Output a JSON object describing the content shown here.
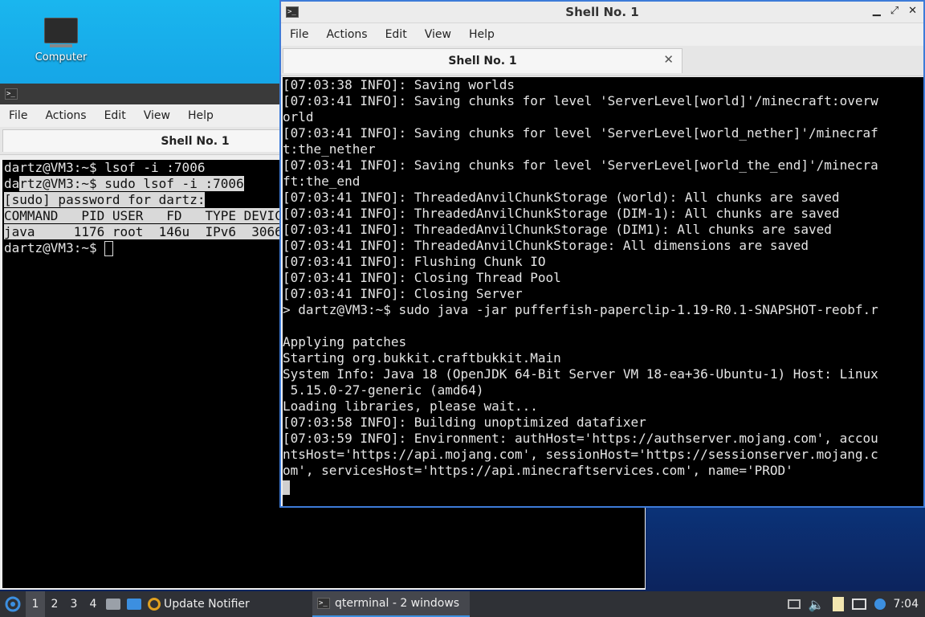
{
  "desktop": {
    "computer_label": "Computer"
  },
  "back_window": {
    "menu": [
      "File",
      "Actions",
      "Edit",
      "View",
      "Help"
    ],
    "tab_title": "Shell No. 1",
    "lines": [
      {
        "text": "dartz@VM3:~$ lsof -i :7006",
        "hl": false
      },
      {
        "text": "dartz@VM3:~$ sudo lsof -i :7006",
        "hl": true,
        "hl_from": 2
      },
      {
        "text": "[sudo] password for dartz:",
        "hl": true
      },
      {
        "text": "COMMAND   PID USER   FD   TYPE DEVIC",
        "hl": true
      },
      {
        "text": "java     1176 root  146u  IPv6  3066",
        "hl": true
      },
      {
        "text": "dartz@VM3:~$ ",
        "hl": false,
        "cursor": true
      }
    ]
  },
  "front_window": {
    "title": "Shell No. 1",
    "menu": [
      "File",
      "Actions",
      "Edit",
      "View",
      "Help"
    ],
    "tab_title": "Shell No. 1",
    "lines": [
      "[07:03:38 INFO]: Saving worlds",
      "[07:03:41 INFO]: Saving chunks for level 'ServerLevel[world]'/minecraft:overw",
      "orld",
      "[07:03:41 INFO]: Saving chunks for level 'ServerLevel[world_nether]'/minecraf",
      "t:the_nether",
      "[07:03:41 INFO]: Saving chunks for level 'ServerLevel[world_the_end]'/minecra",
      "ft:the_end",
      "[07:03:41 INFO]: ThreadedAnvilChunkStorage (world): All chunks are saved",
      "[07:03:41 INFO]: ThreadedAnvilChunkStorage (DIM-1): All chunks are saved",
      "[07:03:41 INFO]: ThreadedAnvilChunkStorage (DIM1): All chunks are saved",
      "[07:03:41 INFO]: ThreadedAnvilChunkStorage: All dimensions are saved",
      "[07:03:41 INFO]: Flushing Chunk IO",
      "[07:03:41 INFO]: Closing Thread Pool",
      "[07:03:41 INFO]: Closing Server",
      "> dartz@VM3:~$ sudo java -jar pufferfish-paperclip-1.19-R0.1-SNAPSHOT-reobf.r",
      "",
      "Applying patches",
      "Starting org.bukkit.craftbukkit.Main",
      "System Info: Java 18 (OpenJDK 64-Bit Server VM 18-ea+36-Ubuntu-1) Host: Linux",
      " 5.15.0-27-generic (amd64)",
      "Loading libraries, please wait...",
      "[07:03:58 INFO]: Building unoptimized datafixer",
      "[07:03:59 INFO]: Environment: authHost='https://authserver.mojang.com', accou",
      "ntsHost='https://api.mojang.com', sessionHost='https://sessionserver.mojang.c",
      "om', servicesHost='https://api.minecraftservices.com', name='PROD'"
    ]
  },
  "taskbar": {
    "workspaces": [
      "1",
      "2",
      "3",
      "4"
    ],
    "active_workspace": "1",
    "update_notifier": "Update Notifier",
    "task_label": "qterminal - 2 windows",
    "clock": "7:04",
    "colors": {
      "bar": "#2f3136",
      "accent": "#3c8fe0"
    }
  }
}
